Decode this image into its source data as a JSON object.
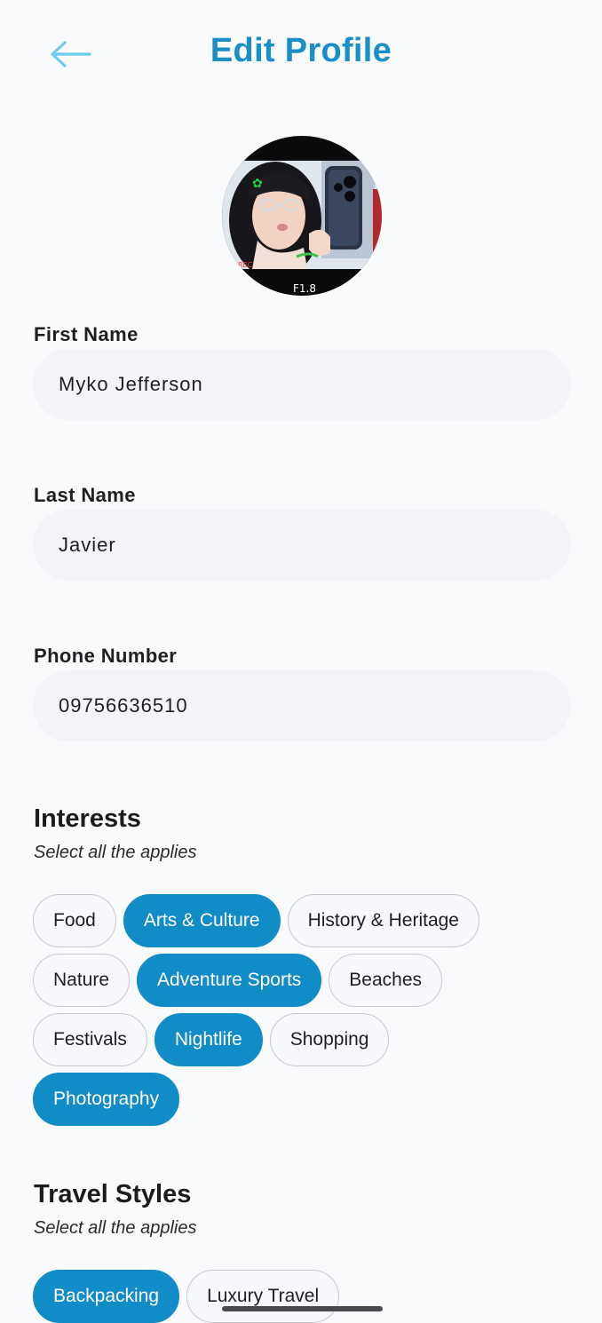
{
  "header": {
    "title": "Edit Profile"
  },
  "form": {
    "first_name": {
      "label": "First Name",
      "value": "Myko Jefferson"
    },
    "last_name": {
      "label": "Last Name",
      "value": "Javier"
    },
    "phone": {
      "label": "Phone Number",
      "value": "09756636510"
    }
  },
  "interests": {
    "title": "Interests",
    "subtitle": "Select all the applies",
    "rows": [
      [
        {
          "label": "Food",
          "selected": false
        },
        {
          "label": "Arts & Culture",
          "selected": true
        },
        {
          "label": "History & Heritage",
          "selected": false
        }
      ],
      [
        {
          "label": "Nature",
          "selected": false
        },
        {
          "label": "Adventure Sports",
          "selected": true
        },
        {
          "label": "Beaches",
          "selected": false
        }
      ],
      [
        {
          "label": "Festivals",
          "selected": false
        },
        {
          "label": "Nightlife",
          "selected": true
        },
        {
          "label": "Shopping",
          "selected": false
        }
      ],
      [
        {
          "label": "Photography",
          "selected": true
        }
      ]
    ]
  },
  "travel_styles": {
    "title": "Travel Styles",
    "subtitle": "Select all the applies",
    "rows": [
      [
        {
          "label": "Backpacking",
          "selected": true
        },
        {
          "label": "Luxury Travel",
          "selected": false
        }
      ]
    ]
  },
  "avatar": {
    "camera_label": "F1.8",
    "rec_label": "REC"
  },
  "colors": {
    "accent": "#128cc6",
    "title": "#1a8fc7",
    "back_arrow": "#6fcbec",
    "chip_border": "#c8cad0"
  },
  "icons": {
    "back": "arrow-left-icon"
  }
}
